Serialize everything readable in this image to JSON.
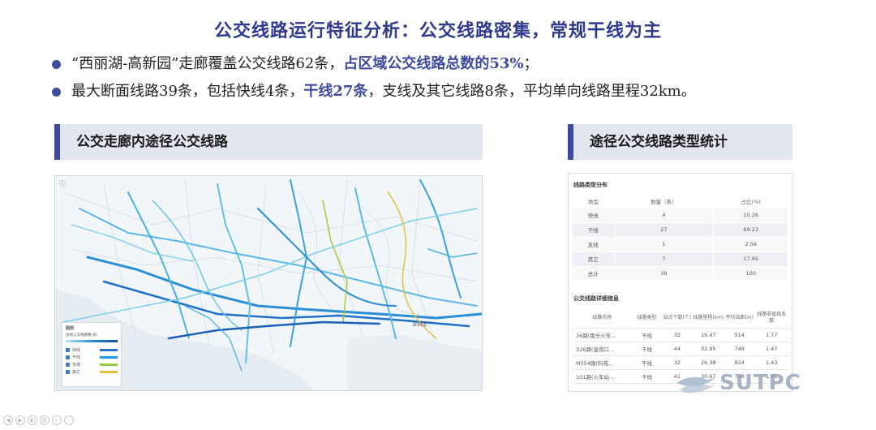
{
  "title": "公交线路运行特征分析：公交线路密集，常规干线为主",
  "bullets": [
    {
      "text_a": "“西丽湖-高新园”走廊覆盖公交线路62条，",
      "highlight": "占区域公交线路总数的53%",
      "text_b": "；"
    },
    {
      "text_a": "最大断面线路39条，包括快线4条，",
      "highlight": "干线27条",
      "text_b": "，支线及其它线路8条，平均单向线路里程32km。"
    }
  ],
  "left_section": {
    "header": "公交走廊内途径公交线路"
  },
  "right_section": {
    "header": "途径公交线路类型统计"
  },
  "map": {
    "info_icon": "ⓘ",
    "place_label": "深圳湾",
    "legend": {
      "title": "图例",
      "subtitle": "途经公交线路数(条)",
      "items": [
        {
          "label": "快线",
          "color": "#2a6fd6"
        },
        {
          "label": "干线",
          "color": "#1a9fe0"
        },
        {
          "label": "支线",
          "color": "#9ccc3c"
        },
        {
          "label": "其它",
          "color": "#e0c040"
        }
      ]
    },
    "scale_label": "0  2.5  5km"
  },
  "type_table": {
    "title": "线路类型分布",
    "headers": [
      "类型",
      "数量（条）",
      "占比(%)"
    ],
    "rows": [
      [
        "快线",
        "4",
        "10.26"
      ],
      [
        "干线",
        "27",
        "69.23"
      ],
      [
        "支线",
        "1",
        "2.56"
      ],
      [
        "其它",
        "7",
        "17.95"
      ],
      [
        "总计",
        "39",
        "100"
      ]
    ]
  },
  "detail_table": {
    "title": "公交线路详细信息",
    "headers": [
      "线路名称",
      "线路类型",
      "站点个数(个)",
      "线路里程(km)",
      "平均站距(m)",
      "线路非直线系数"
    ],
    "rows": [
      [
        "36路(南头火车...",
        "干线",
        "32",
        "16.47",
        "514",
        "1.77"
      ],
      [
        "326路(皇岗口...",
        "干线",
        "44",
        "32.95",
        "748",
        "1.47"
      ],
      [
        "M554路(科苑...",
        "干线",
        "32",
        "26.38",
        "824",
        "1.43"
      ],
      [
        "101路(火车站-...",
        "干线",
        "41",
        "30.67",
        "748",
        "1.41"
      ]
    ]
  },
  "logo": {
    "text": "SUTPC"
  },
  "controls": [
    "◀",
    "▶",
    "◐",
    "⧉",
    "⌕",
    "⋯"
  ],
  "colors": {
    "accent": "#3d4a9e",
    "title": "#2f3a8f"
  }
}
